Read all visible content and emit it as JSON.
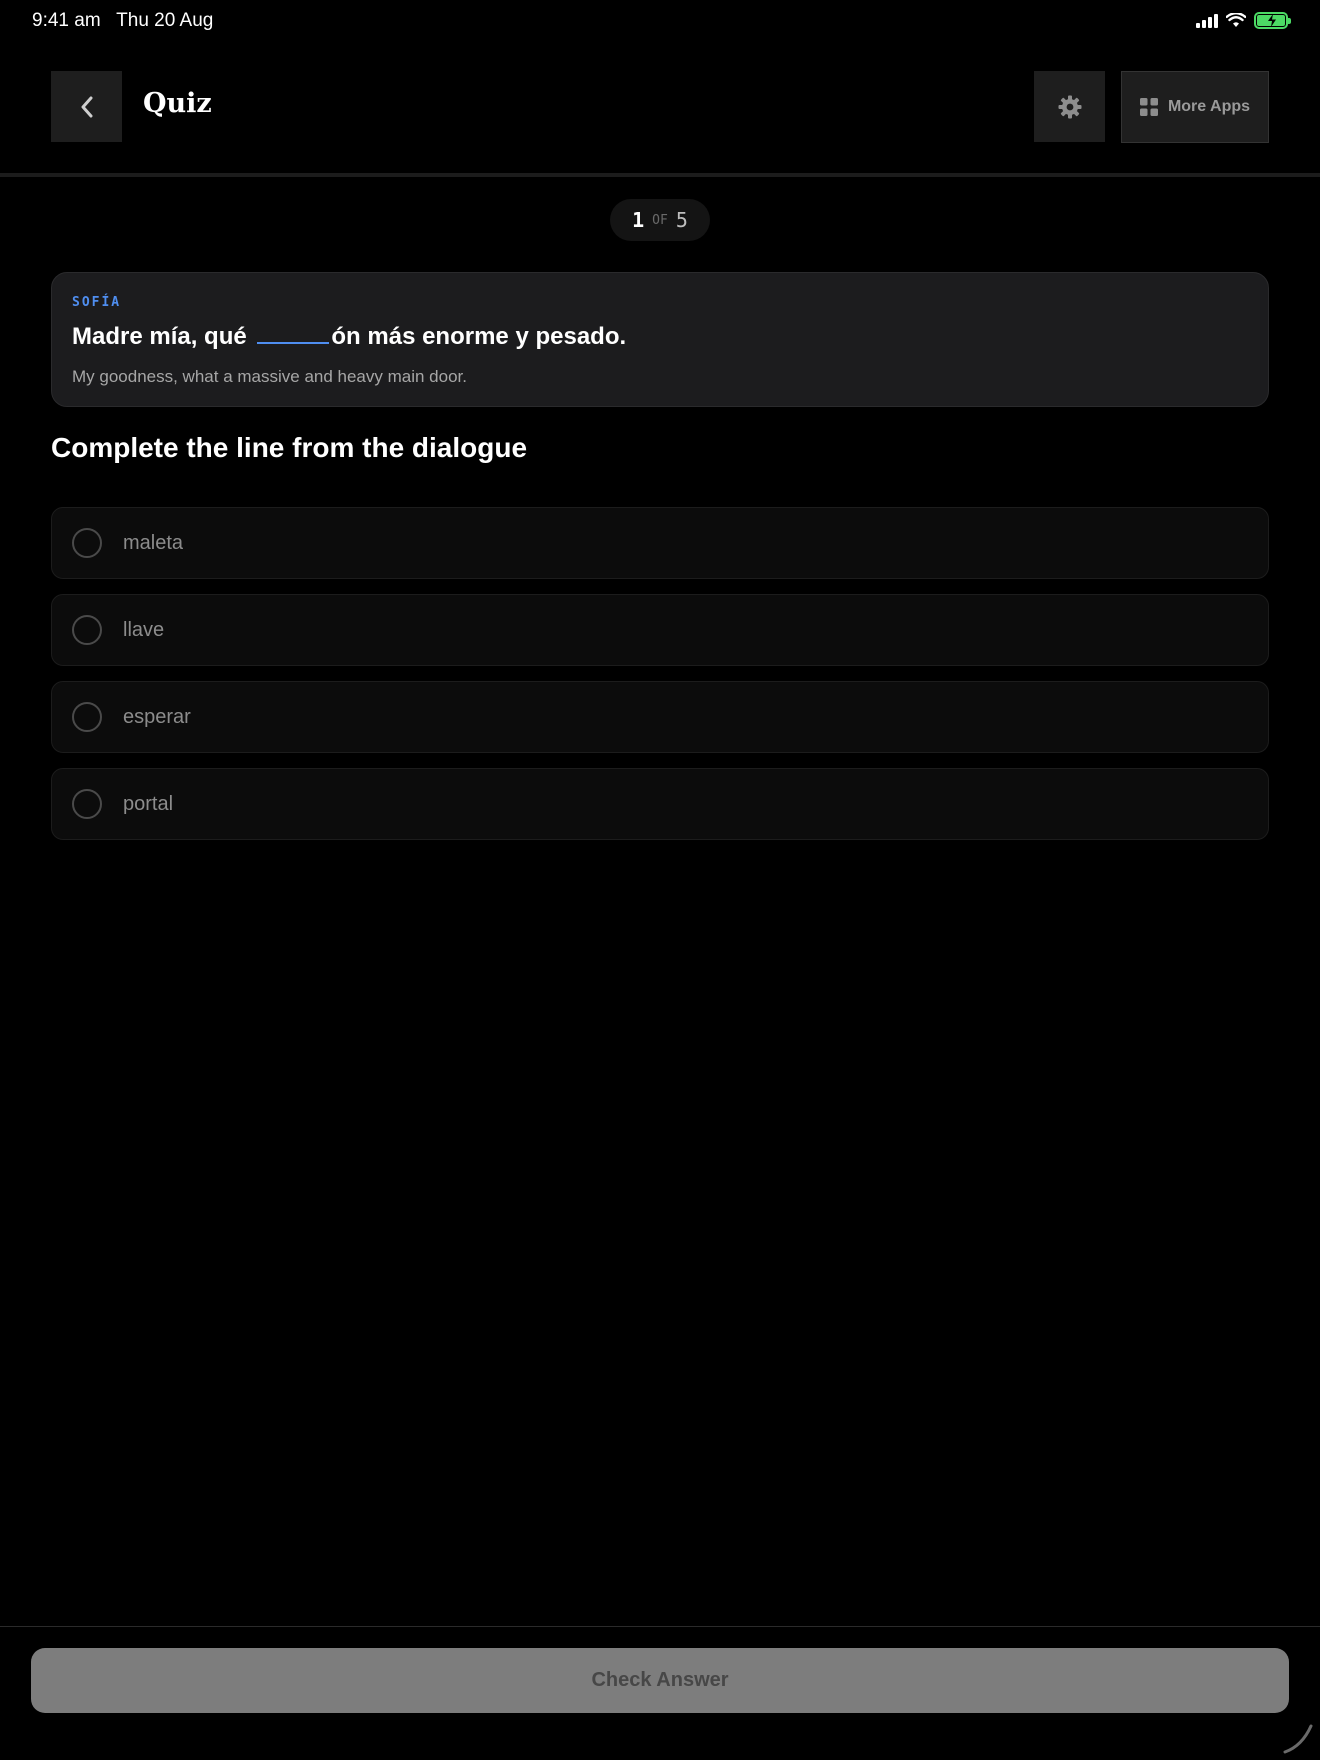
{
  "status_bar": {
    "time_date": "9:41 am   Thu 20 Aug",
    "battery_color": "#4cd964"
  },
  "header": {
    "title": "Quiz",
    "back_icon": "chevron-left-icon",
    "settings_icon": "gear-icon",
    "more_apps_icon": "grid-icon",
    "more_apps_label": "More Apps"
  },
  "progress": {
    "current": "1",
    "of_label": "OF",
    "total": "5"
  },
  "dialogue": {
    "speaker": "SOFÍA",
    "line_before": "Madre mía, qué ",
    "line_after": "ón más enorme y pesado.",
    "translation": "My goodness, what a massive and heavy main door.",
    "accent_color": "#4f8ef0"
  },
  "question": "Complete the line from the dialogue",
  "options": [
    {
      "label": "maleta"
    },
    {
      "label": "llave"
    },
    {
      "label": "esperar"
    },
    {
      "label": "portal"
    }
  ],
  "footer": {
    "check_label": "Check Answer"
  }
}
